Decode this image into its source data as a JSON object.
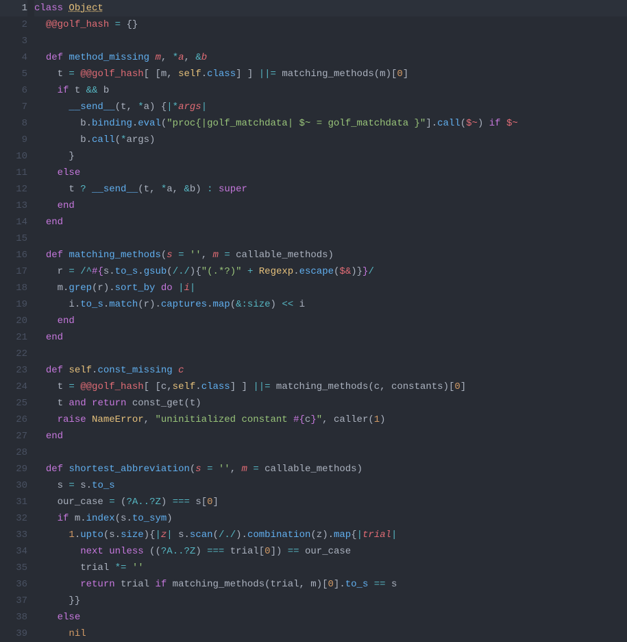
{
  "meta": {
    "language": "ruby",
    "active_line": 1,
    "line_count": 39,
    "theme": "one-dark",
    "font": "monospace"
  },
  "lines": [
    {
      "n": 1,
      "tokens": [
        [
          "kw",
          "class"
        ],
        [
          "punc",
          " "
        ],
        [
          "const-u",
          "Object"
        ]
      ]
    },
    {
      "n": 2,
      "tokens": [
        [
          "indent",
          "  "
        ],
        [
          "var",
          "@@golf_hash"
        ],
        [
          "punc",
          " "
        ],
        [
          "op",
          "="
        ],
        [
          "punc",
          " {}"
        ]
      ]
    },
    {
      "n": 3,
      "tokens": []
    },
    {
      "n": 4,
      "tokens": [
        [
          "indent",
          "  "
        ],
        [
          "kw",
          "def"
        ],
        [
          "punc",
          " "
        ],
        [
          "def",
          "method_missing"
        ],
        [
          "punc",
          " "
        ],
        [
          "param",
          "m"
        ],
        [
          "punc",
          ", "
        ],
        [
          "op",
          "*"
        ],
        [
          "param",
          "a"
        ],
        [
          "punc",
          ", "
        ],
        [
          "op",
          "&"
        ],
        [
          "param",
          "b"
        ]
      ]
    },
    {
      "n": 5,
      "tokens": [
        [
          "indent",
          "    "
        ],
        [
          "punc",
          "t "
        ],
        [
          "op",
          "="
        ],
        [
          "punc",
          " "
        ],
        [
          "var",
          "@@golf_hash"
        ],
        [
          "punc",
          "[ [m, "
        ],
        [
          "self",
          "self"
        ],
        [
          "punc",
          "."
        ],
        [
          "def",
          "class"
        ],
        [
          "punc",
          "] ] "
        ],
        [
          "op",
          "||="
        ],
        [
          "punc",
          " matching_methods(m)["
        ],
        [
          "num",
          "0"
        ],
        [
          "punc",
          "]"
        ]
      ]
    },
    {
      "n": 6,
      "tokens": [
        [
          "indent",
          "    "
        ],
        [
          "kw",
          "if"
        ],
        [
          "punc",
          " t "
        ],
        [
          "op",
          "&&"
        ],
        [
          "punc",
          " b"
        ]
      ]
    },
    {
      "n": 7,
      "tokens": [
        [
          "indent",
          "      "
        ],
        [
          "def",
          "__send__"
        ],
        [
          "punc",
          "(t, "
        ],
        [
          "op",
          "*"
        ],
        [
          "punc",
          "a) {"
        ],
        [
          "op",
          "|"
        ],
        [
          "op",
          "*"
        ],
        [
          "param",
          "args"
        ],
        [
          "op",
          "|"
        ]
      ]
    },
    {
      "n": 8,
      "tokens": [
        [
          "indent",
          "        "
        ],
        [
          "punc",
          "b."
        ],
        [
          "def",
          "binding"
        ],
        [
          "punc",
          "."
        ],
        [
          "def",
          "eval"
        ],
        [
          "punc",
          "("
        ],
        [
          "str",
          "\"proc{|golf_matchdata| $~ = golf_matchdata }\""
        ],
        [
          "punc",
          "]."
        ],
        [
          "def",
          "call"
        ],
        [
          "punc",
          "("
        ],
        [
          "var",
          "$~"
        ],
        [
          "punc",
          ") "
        ],
        [
          "kw",
          "if"
        ],
        [
          "punc",
          " "
        ],
        [
          "var",
          "$~"
        ]
      ]
    },
    {
      "n": 9,
      "tokens": [
        [
          "indent",
          "        "
        ],
        [
          "punc",
          "b."
        ],
        [
          "def",
          "call"
        ],
        [
          "punc",
          "("
        ],
        [
          "op",
          "*"
        ],
        [
          "punc",
          "args)"
        ]
      ]
    },
    {
      "n": 10,
      "tokens": [
        [
          "indent",
          "      "
        ],
        [
          "punc",
          "}"
        ]
      ]
    },
    {
      "n": 11,
      "tokens": [
        [
          "indent",
          "    "
        ],
        [
          "kw",
          "else"
        ]
      ]
    },
    {
      "n": 12,
      "tokens": [
        [
          "indent",
          "      "
        ],
        [
          "punc",
          "t "
        ],
        [
          "op",
          "?"
        ],
        [
          "punc",
          " "
        ],
        [
          "def",
          "__send__"
        ],
        [
          "punc",
          "(t, "
        ],
        [
          "op",
          "*"
        ],
        [
          "punc",
          "a, "
        ],
        [
          "op",
          "&"
        ],
        [
          "punc",
          "b) "
        ],
        [
          "op",
          ":"
        ],
        [
          "punc",
          " "
        ],
        [
          "kw",
          "super"
        ]
      ]
    },
    {
      "n": 13,
      "tokens": [
        [
          "indent",
          "    "
        ],
        [
          "kw",
          "end"
        ]
      ]
    },
    {
      "n": 14,
      "tokens": [
        [
          "indent",
          "  "
        ],
        [
          "kw",
          "end"
        ]
      ]
    },
    {
      "n": 15,
      "tokens": []
    },
    {
      "n": 16,
      "tokens": [
        [
          "indent",
          "  "
        ],
        [
          "kw",
          "def"
        ],
        [
          "punc",
          " "
        ],
        [
          "def",
          "matching_methods"
        ],
        [
          "punc",
          "("
        ],
        [
          "param",
          "s"
        ],
        [
          "punc",
          " "
        ],
        [
          "op",
          "="
        ],
        [
          "punc",
          " "
        ],
        [
          "str",
          "''"
        ],
        [
          "punc",
          ", "
        ],
        [
          "param",
          "m"
        ],
        [
          "punc",
          " "
        ],
        [
          "op",
          "="
        ],
        [
          "punc",
          " callable_methods)"
        ]
      ]
    },
    {
      "n": 17,
      "tokens": [
        [
          "indent",
          "    "
        ],
        [
          "punc",
          "r "
        ],
        [
          "op",
          "="
        ],
        [
          "punc",
          " "
        ],
        [
          "regex",
          "/^"
        ],
        [
          "interp",
          "#{"
        ],
        [
          "punc",
          "s."
        ],
        [
          "def",
          "to_s"
        ],
        [
          "punc",
          "."
        ],
        [
          "def",
          "gsub"
        ],
        [
          "punc",
          "("
        ],
        [
          "regex",
          "/./"
        ],
        [
          "punc",
          "){"
        ],
        [
          "str",
          "\"(.*?)\""
        ],
        [
          "punc",
          " "
        ],
        [
          "op",
          "+"
        ],
        [
          "punc",
          " "
        ],
        [
          "const",
          "Regexp"
        ],
        [
          "punc",
          "."
        ],
        [
          "def",
          "escape"
        ],
        [
          "punc",
          "("
        ],
        [
          "var",
          "$&"
        ],
        [
          "punc",
          ")}"
        ],
        [
          "interp",
          "}"
        ],
        [
          "regex",
          "/"
        ]
      ]
    },
    {
      "n": 18,
      "tokens": [
        [
          "indent",
          "    "
        ],
        [
          "punc",
          "m."
        ],
        [
          "def",
          "grep"
        ],
        [
          "punc",
          "(r)."
        ],
        [
          "def",
          "sort_by"
        ],
        [
          "punc",
          " "
        ],
        [
          "kw",
          "do"
        ],
        [
          "punc",
          " "
        ],
        [
          "op",
          "|"
        ],
        [
          "param",
          "i"
        ],
        [
          "op",
          "|"
        ]
      ]
    },
    {
      "n": 19,
      "tokens": [
        [
          "indent",
          "      "
        ],
        [
          "punc",
          "i."
        ],
        [
          "def",
          "to_s"
        ],
        [
          "punc",
          "."
        ],
        [
          "def",
          "match"
        ],
        [
          "punc",
          "(r)."
        ],
        [
          "def",
          "captures"
        ],
        [
          "punc",
          "."
        ],
        [
          "def",
          "map"
        ],
        [
          "punc",
          "("
        ],
        [
          "op",
          "&"
        ],
        [
          "sym",
          ":size"
        ],
        [
          "punc",
          ") "
        ],
        [
          "op",
          "<<"
        ],
        [
          "punc",
          " i"
        ]
      ]
    },
    {
      "n": 20,
      "tokens": [
        [
          "indent",
          "    "
        ],
        [
          "kw",
          "end"
        ]
      ]
    },
    {
      "n": 21,
      "tokens": [
        [
          "indent",
          "  "
        ],
        [
          "kw",
          "end"
        ]
      ]
    },
    {
      "n": 22,
      "tokens": []
    },
    {
      "n": 23,
      "tokens": [
        [
          "indent",
          "  "
        ],
        [
          "kw",
          "def"
        ],
        [
          "punc",
          " "
        ],
        [
          "self",
          "self"
        ],
        [
          "punc",
          "."
        ],
        [
          "def",
          "const_missing"
        ],
        [
          "punc",
          " "
        ],
        [
          "param",
          "c"
        ]
      ]
    },
    {
      "n": 24,
      "tokens": [
        [
          "indent",
          "    "
        ],
        [
          "punc",
          "t "
        ],
        [
          "op",
          "="
        ],
        [
          "punc",
          " "
        ],
        [
          "var",
          "@@golf_hash"
        ],
        [
          "punc",
          "[ [c,"
        ],
        [
          "self",
          "self"
        ],
        [
          "punc",
          "."
        ],
        [
          "def",
          "class"
        ],
        [
          "punc",
          "] ] "
        ],
        [
          "op",
          "||="
        ],
        [
          "punc",
          " matching_methods(c, constants)["
        ],
        [
          "num",
          "0"
        ],
        [
          "punc",
          "]"
        ]
      ]
    },
    {
      "n": 25,
      "tokens": [
        [
          "indent",
          "    "
        ],
        [
          "punc",
          "t "
        ],
        [
          "kw",
          "and"
        ],
        [
          "punc",
          " "
        ],
        [
          "kw",
          "return"
        ],
        [
          "punc",
          " const_get(t)"
        ]
      ]
    },
    {
      "n": 26,
      "tokens": [
        [
          "indent",
          "    "
        ],
        [
          "kw",
          "raise"
        ],
        [
          "punc",
          " "
        ],
        [
          "const",
          "NameError"
        ],
        [
          "punc",
          ", "
        ],
        [
          "str",
          "\"uninitialized constant "
        ],
        [
          "interp",
          "#{"
        ],
        [
          "punc",
          "c"
        ],
        [
          "interp",
          "}"
        ],
        [
          "str",
          "\""
        ],
        [
          "punc",
          ", caller("
        ],
        [
          "num",
          "1"
        ],
        [
          "punc",
          ")"
        ]
      ]
    },
    {
      "n": 27,
      "tokens": [
        [
          "indent",
          "  "
        ],
        [
          "kw",
          "end"
        ]
      ]
    },
    {
      "n": 28,
      "tokens": []
    },
    {
      "n": 29,
      "tokens": [
        [
          "indent",
          "  "
        ],
        [
          "kw",
          "def"
        ],
        [
          "punc",
          " "
        ],
        [
          "def",
          "shortest_abbreviation"
        ],
        [
          "punc",
          "("
        ],
        [
          "param",
          "s"
        ],
        [
          "punc",
          " "
        ],
        [
          "op",
          "="
        ],
        [
          "punc",
          " "
        ],
        [
          "str",
          "''"
        ],
        [
          "punc",
          ", "
        ],
        [
          "param",
          "m"
        ],
        [
          "punc",
          " "
        ],
        [
          "op",
          "="
        ],
        [
          "punc",
          " callable_methods)"
        ]
      ]
    },
    {
      "n": 30,
      "tokens": [
        [
          "indent",
          "    "
        ],
        [
          "punc",
          "s "
        ],
        [
          "op",
          "="
        ],
        [
          "punc",
          " s."
        ],
        [
          "def",
          "to_s"
        ]
      ]
    },
    {
      "n": 31,
      "tokens": [
        [
          "indent",
          "    "
        ],
        [
          "punc",
          "our_case "
        ],
        [
          "op",
          "="
        ],
        [
          "punc",
          " ("
        ],
        [
          "sym",
          "?A"
        ],
        [
          "op",
          ".."
        ],
        [
          "sym",
          "?Z"
        ],
        [
          "punc",
          ") "
        ],
        [
          "op",
          "==="
        ],
        [
          "punc",
          " s["
        ],
        [
          "num",
          "0"
        ],
        [
          "punc",
          "]"
        ]
      ]
    },
    {
      "n": 32,
      "tokens": [
        [
          "indent",
          "    "
        ],
        [
          "kw",
          "if"
        ],
        [
          "punc",
          " m."
        ],
        [
          "def",
          "index"
        ],
        [
          "punc",
          "(s."
        ],
        [
          "def",
          "to_sym"
        ],
        [
          "punc",
          ")"
        ]
      ]
    },
    {
      "n": 33,
      "tokens": [
        [
          "indent",
          "      "
        ],
        [
          "num",
          "1"
        ],
        [
          "punc",
          "."
        ],
        [
          "def",
          "upto"
        ],
        [
          "punc",
          "(s."
        ],
        [
          "def",
          "size"
        ],
        [
          "punc",
          "){"
        ],
        [
          "op",
          "|"
        ],
        [
          "param",
          "z"
        ],
        [
          "op",
          "|"
        ],
        [
          "punc",
          " s."
        ],
        [
          "def",
          "scan"
        ],
        [
          "punc",
          "("
        ],
        [
          "regex",
          "/./"
        ],
        [
          "punc",
          ")."
        ],
        [
          "def",
          "combination"
        ],
        [
          "punc",
          "(z)."
        ],
        [
          "def",
          "map"
        ],
        [
          "punc",
          "{"
        ],
        [
          "op",
          "|"
        ],
        [
          "param",
          "trial"
        ],
        [
          "op",
          "|"
        ]
      ]
    },
    {
      "n": 34,
      "tokens": [
        [
          "indent",
          "        "
        ],
        [
          "kw",
          "next"
        ],
        [
          "punc",
          " "
        ],
        [
          "kw",
          "unless"
        ],
        [
          "punc",
          " (("
        ],
        [
          "sym",
          "?A"
        ],
        [
          "op",
          ".."
        ],
        [
          "sym",
          "?Z"
        ],
        [
          "punc",
          ") "
        ],
        [
          "op",
          "==="
        ],
        [
          "punc",
          " trial["
        ],
        [
          "num",
          "0"
        ],
        [
          "punc",
          "]) "
        ],
        [
          "op",
          "=="
        ],
        [
          "punc",
          " our_case"
        ]
      ]
    },
    {
      "n": 35,
      "tokens": [
        [
          "indent",
          "        "
        ],
        [
          "punc",
          "trial "
        ],
        [
          "op",
          "*="
        ],
        [
          "punc",
          " "
        ],
        [
          "str",
          "''"
        ]
      ]
    },
    {
      "n": 36,
      "tokens": [
        [
          "indent",
          "        "
        ],
        [
          "kw",
          "return"
        ],
        [
          "punc",
          " trial "
        ],
        [
          "kw",
          "if"
        ],
        [
          "punc",
          " matching_methods(trial, m)["
        ],
        [
          "num",
          "0"
        ],
        [
          "punc",
          "]."
        ],
        [
          "def",
          "to_s"
        ],
        [
          "punc",
          " "
        ],
        [
          "op",
          "=="
        ],
        [
          "punc",
          " s"
        ]
      ]
    },
    {
      "n": 37,
      "tokens": [
        [
          "indent",
          "      "
        ],
        [
          "punc",
          "}}"
        ]
      ]
    },
    {
      "n": 38,
      "tokens": [
        [
          "indent",
          "    "
        ],
        [
          "kw",
          "else"
        ]
      ]
    },
    {
      "n": 39,
      "tokens": [
        [
          "indent",
          "      "
        ],
        [
          "num",
          "nil"
        ]
      ]
    }
  ]
}
